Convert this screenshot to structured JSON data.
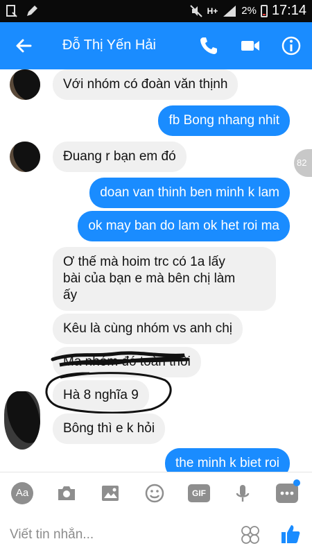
{
  "status_bar": {
    "battery": "2%",
    "time": "17:14",
    "network": "H+"
  },
  "header": {
    "contact_name": "Đỗ Thị Yến Hải"
  },
  "messages": [
    {
      "side": "in",
      "text": "Với nhóm có đoàn văn thịnh"
    },
    {
      "side": "out",
      "text": "fb Bong nhang nhit"
    },
    {
      "side": "in",
      "text": "Đuang r bạn em đó"
    },
    {
      "side": "out",
      "text": "doan van thinh ben minh k lam"
    },
    {
      "side": "out",
      "text": "ok may ban do lam ok het roi ma"
    },
    {
      "side": "in",
      "lines": [
        "Ơ thế mà hoim trc có 1a lấy",
        "bài của bạn e mà bên chị làm",
        "ấy"
      ]
    },
    {
      "side": "in",
      "text": "Kêu là cùng nhóm vs anh chị"
    },
    {
      "side": "in",
      "text": "Ma nhóm đó toàn thôi"
    },
    {
      "side": "in",
      "text": "Hà 8 nghĩa 9"
    },
    {
      "side": "in",
      "text": "Bông thì e k hỏi"
    },
    {
      "side": "out",
      "text": "the minh k biet roi"
    }
  ],
  "unread_counter": "82",
  "composer": {
    "placeholder": "Viết tin nhắn...",
    "aa_label": "Aa",
    "gif_label": "GIF"
  },
  "colors": {
    "brand": "#1a8cff",
    "incoming_bubble": "#f0f0f0",
    "badge": "#1a8cff"
  }
}
